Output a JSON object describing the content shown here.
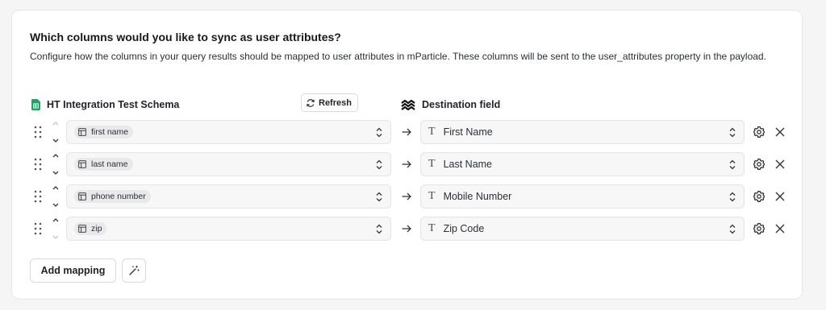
{
  "section": {
    "title": "Which columns would you like to sync as user attributes?",
    "description": "Configure how the columns in your query results should be mapped to user attributes in mParticle. These columns will be sent to the user_attributes property in the payload."
  },
  "source": {
    "label": "HT Integration Test Schema",
    "icon": "google-sheets-icon",
    "refresh_label": "Refresh"
  },
  "destination": {
    "label": "Destination field",
    "icon": "mparticle-logo-icon"
  },
  "mappings": [
    {
      "source_column": "first name",
      "destination_field": "First Name"
    },
    {
      "source_column": "last name",
      "destination_field": "Last Name"
    },
    {
      "source_column": "phone number",
      "destination_field": "Mobile Number"
    },
    {
      "source_column": "zip",
      "destination_field": "Zip Code"
    }
  ],
  "actions": {
    "add_mapping_label": "Add mapping"
  },
  "colors": {
    "sheets_green": "#1ea362",
    "border": "#e3e4e7",
    "field_bg": "#f7f7f8"
  }
}
